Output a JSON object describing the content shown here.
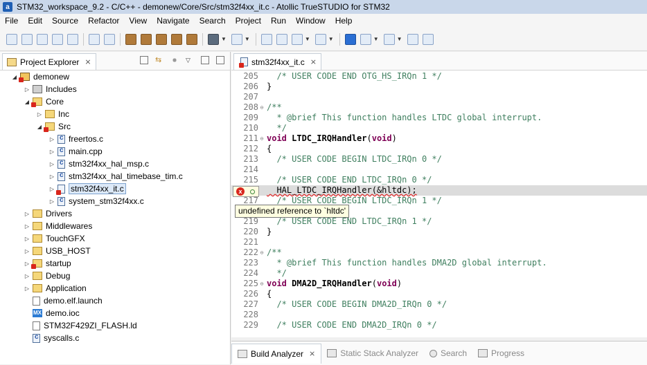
{
  "window": {
    "title": "STM32_workspace_9.2 - C/C++ - demonew/Core/Src/stm32f4xx_it.c - Atollic TrueSTUDIO for STM32",
    "app_icon_glyph": "a"
  },
  "menu": [
    "File",
    "Edit",
    "Source",
    "Refactor",
    "View",
    "Navigate",
    "Search",
    "Project",
    "Run",
    "Window",
    "Help"
  ],
  "project_explorer": {
    "tab_label": "Project Explorer",
    "close_glyph": "⨯",
    "tree": [
      {
        "label": "demonew",
        "depth": 0,
        "icon": "project-icon",
        "expanded": true
      },
      {
        "label": "Includes",
        "depth": 1,
        "icon": "includes-icon",
        "expanded": false
      },
      {
        "label": "Core",
        "depth": 1,
        "icon": "folder-error-icon",
        "expanded": true
      },
      {
        "label": "Inc",
        "depth": 2,
        "icon": "folder-icon",
        "expanded": false
      },
      {
        "label": "Src",
        "depth": 2,
        "icon": "folder-error-icon",
        "expanded": true
      },
      {
        "label": "freertos.c",
        "depth": 3,
        "icon": "c-file-icon",
        "expanded": false
      },
      {
        "label": "main.cpp",
        "depth": 3,
        "icon": "c-file-icon",
        "expanded": false
      },
      {
        "label": "stm32f4xx_hal_msp.c",
        "depth": 3,
        "icon": "c-file-icon",
        "expanded": false
      },
      {
        "label": "stm32f4xx_hal_timebase_tim.c",
        "depth": 3,
        "icon": "c-file-icon",
        "expanded": false
      },
      {
        "label": "stm32f4xx_it.c",
        "depth": 3,
        "icon": "c-file-error-icon",
        "expanded": false,
        "selected": true
      },
      {
        "label": "system_stm32f4xx.c",
        "depth": 3,
        "icon": "c-file-icon",
        "expanded": false
      },
      {
        "label": "Drivers",
        "depth": 1,
        "icon": "folder-icon",
        "expanded": false
      },
      {
        "label": "Middlewares",
        "depth": 1,
        "icon": "folder-icon",
        "expanded": false
      },
      {
        "label": "TouchGFX",
        "depth": 1,
        "icon": "folder-icon",
        "expanded": false
      },
      {
        "label": "USB_HOST",
        "depth": 1,
        "icon": "folder-icon",
        "expanded": false
      },
      {
        "label": "startup",
        "depth": 1,
        "icon": "folder-error-icon",
        "expanded": false
      },
      {
        "label": "Debug",
        "depth": 1,
        "icon": "folder-icon",
        "expanded": false
      },
      {
        "label": "Application",
        "depth": 1,
        "icon": "folder-icon",
        "expanded": false
      },
      {
        "label": "demo.elf.launch",
        "depth": 1,
        "icon": "launch-file-icon",
        "leaf": true
      },
      {
        "label": "demo.ioc",
        "depth": 1,
        "icon": "mx-file-icon",
        "leaf": true,
        "icon_text": "MX"
      },
      {
        "label": "STM32F429ZI_FLASH.ld",
        "depth": 1,
        "icon": "text-file-icon",
        "leaf": true
      },
      {
        "label": "syscalls.c",
        "depth": 1,
        "icon": "c-file-icon",
        "leaf": true
      }
    ]
  },
  "editor": {
    "tab_label": "stm32f4xx_it.c",
    "close_glyph": "⨯",
    "lines": [
      {
        "n": "205",
        "fold": "",
        "text": "  /* USER CODE END OTG_HS_IRQn 1 */",
        "kind": "comment"
      },
      {
        "n": "206",
        "fold": "",
        "text": "}",
        "kind": "plain"
      },
      {
        "n": "207",
        "fold": "",
        "text": "",
        "kind": "plain"
      },
      {
        "n": "208",
        "fold": "⊖",
        "text": "/**",
        "kind": "comment"
      },
      {
        "n": "209",
        "fold": "",
        "text": "  * @brief This function handles LTDC global interrupt.",
        "kind": "comment"
      },
      {
        "n": "210",
        "fold": "",
        "text": "  */",
        "kind": "comment"
      },
      {
        "n": "211",
        "fold": "⊖",
        "kw": "void",
        "fn": " LTDC_IRQHandler",
        "rest": "(",
        "kw2": "void",
        "rest2": ")",
        "kind": "decl"
      },
      {
        "n": "212",
        "fold": "",
        "text": "{",
        "kind": "plain"
      },
      {
        "n": "213",
        "fold": "",
        "text": "  /* USER CODE BEGIN LTDC_IRQn 0 */",
        "kind": "comment"
      },
      {
        "n": "214",
        "fold": "",
        "text": "",
        "kind": "plain"
      },
      {
        "n": "215",
        "fold": "",
        "text": "  /* USER CODE END LTDC_IRQn 0 */",
        "kind": "comment"
      },
      {
        "n": "216",
        "fold": "",
        "text": "  HAL_LTDC_IRQHandler(&hltdc);",
        "kind": "error"
      },
      {
        "n": "217",
        "fold": "",
        "text": "  /* USER CODE BEGIN LTDC_IRQn 1 */",
        "kind": "comment"
      },
      {
        "n": "218",
        "fold": "",
        "text": "",
        "kind": "plain"
      },
      {
        "n": "219",
        "fold": "",
        "text": "  /* USER CODE END LTDC_IRQn 1 */",
        "kind": "comment"
      },
      {
        "n": "220",
        "fold": "",
        "text": "}",
        "kind": "plain"
      },
      {
        "n": "221",
        "fold": "",
        "text": "",
        "kind": "plain"
      },
      {
        "n": "222",
        "fold": "⊖",
        "text": "/**",
        "kind": "comment"
      },
      {
        "n": "223",
        "fold": "",
        "text": "  * @brief This function handles DMA2D global interrupt.",
        "kind": "comment"
      },
      {
        "n": "224",
        "fold": "",
        "text": "  */",
        "kind": "comment"
      },
      {
        "n": "225",
        "fold": "⊖",
        "kw": "void",
        "fn": " DMA2D_IRQHandler",
        "rest": "(",
        "kw2": "void",
        "rest2": ")",
        "kind": "decl"
      },
      {
        "n": "226",
        "fold": "",
        "text": "{",
        "kind": "plain"
      },
      {
        "n": "227",
        "fold": "",
        "text": "  /* USER CODE BEGIN DMA2D_IRQn 0 */",
        "kind": "comment"
      },
      {
        "n": "228",
        "fold": "",
        "text": "",
        "kind": "plain"
      },
      {
        "n": "229",
        "fold": "",
        "text": "  /* USER CODE END DMA2D_IRQn 0 */",
        "kind": "comment"
      }
    ],
    "error_tooltip": "undefined reference to `hltdc'",
    "error_glyph": "x"
  },
  "bottom_tabs": [
    {
      "label": "Build Analyzer",
      "active": true,
      "close": "⨯"
    },
    {
      "label": "Static Stack Analyzer",
      "active": false
    },
    {
      "label": "Search",
      "active": false
    },
    {
      "label": "Progress",
      "active": false
    }
  ],
  "colors": {
    "comment": "#3f7f5f",
    "keyword": "#7f0055",
    "error": "#d9261c",
    "selection": "#dce9f8"
  }
}
